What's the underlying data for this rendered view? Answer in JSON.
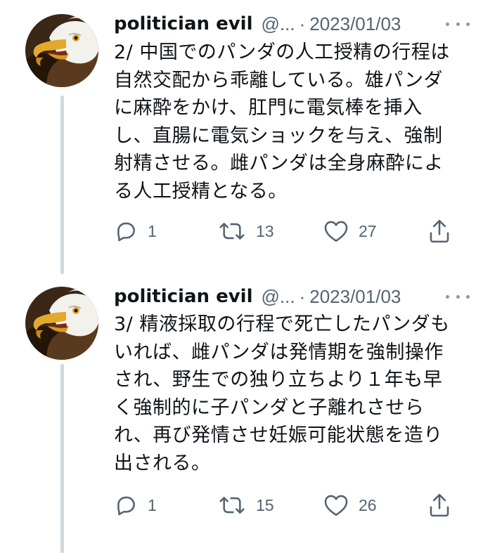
{
  "colors": {
    "text_primary": "#0f1419",
    "text_secondary": "#536471",
    "thread_line": "#cfd9de",
    "icon": "#536471"
  },
  "tweets": [
    {
      "author_name": "politician evil",
      "handle": "@...",
      "separator": "·",
      "date": "2023/01/03",
      "avatar_icon": "bald-eagle-avatar",
      "text": "2/ 中国でのパンダの人工授精の行程は\n自然交配から乖離している。雄パンダ\nに麻酔をかけ、肛門に電気棒を挿入\nし、直腸に電気ショックを与え、強制\n射精させる。雌パンダは全身麻酔によ\nる人工授精となる。",
      "replies": "1",
      "retweets": "13",
      "likes": "27"
    },
    {
      "author_name": "politician evil",
      "handle": "@...",
      "separator": "·",
      "date": "2023/01/03",
      "avatar_icon": "bald-eagle-avatar",
      "text": "3/ 精液採取の行程で死亡したパンダも\nいれば、雌パンダは発情期を強制操作\nされ、野生での独り立ちより１年も早\nく強制的に子パンダと子離れさせら\nれ、再び発情させ妊娠可能状態を造り\n出される。",
      "replies": "1",
      "retweets": "15",
      "likes": "26"
    }
  ]
}
